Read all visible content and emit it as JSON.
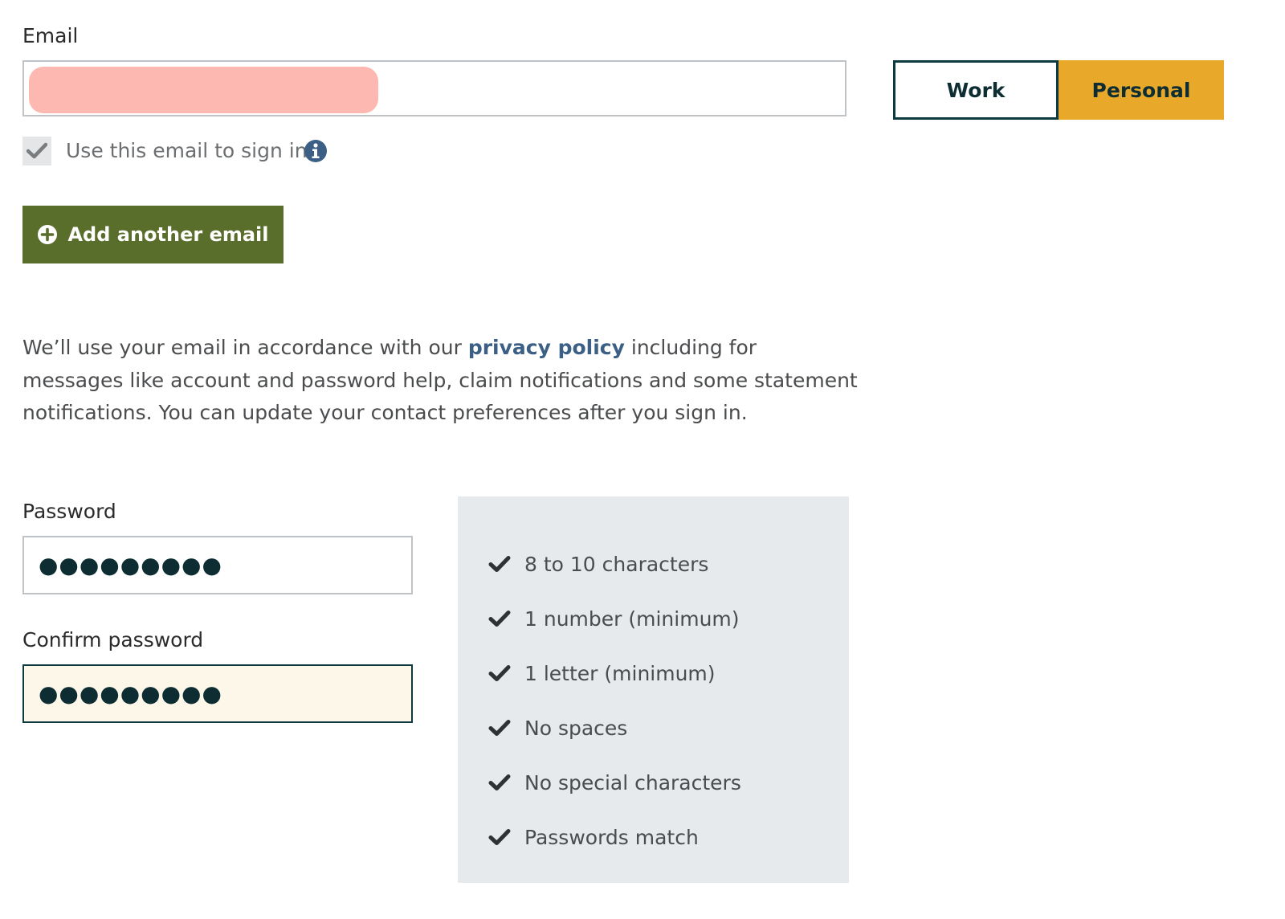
{
  "email": {
    "label": "Email",
    "value": "",
    "redaction_color": "#fdb8b1",
    "type_toggle": {
      "options": [
        "Work",
        "Personal"
      ],
      "selected": "Personal",
      "selected_color": "#e8a92a"
    },
    "use_to_sign_in": {
      "label": "Use this email to sign in",
      "checked": true,
      "info_icon": "info-circle-icon"
    },
    "add_button": {
      "label": "Add another email",
      "icon": "plus-circle-icon",
      "color": "#5a6e2c"
    }
  },
  "privacy": {
    "text_before": "We’ll use your email in accordance with our ",
    "link_text": "privacy policy",
    "text_after": " including for messages like account and password help, claim notifications and some statement notifications. You can update your contact preferences after you sign in."
  },
  "password": {
    "label": "Password",
    "masked_value": "●●●●●●●●●"
  },
  "confirm_password": {
    "label": "Confirm password",
    "masked_value": "●●●●●●●●●",
    "focused_background": "#fdf7e9"
  },
  "requirements": [
    {
      "label": "8 to 10 characters",
      "met": true
    },
    {
      "label": "1 number (minimum)",
      "met": true
    },
    {
      "label": "1 letter (minimum)",
      "met": true
    },
    {
      "label": "No spaces",
      "met": true
    },
    {
      "label": "No special characters",
      "met": true
    },
    {
      "label": "Passwords match",
      "met": true
    }
  ]
}
